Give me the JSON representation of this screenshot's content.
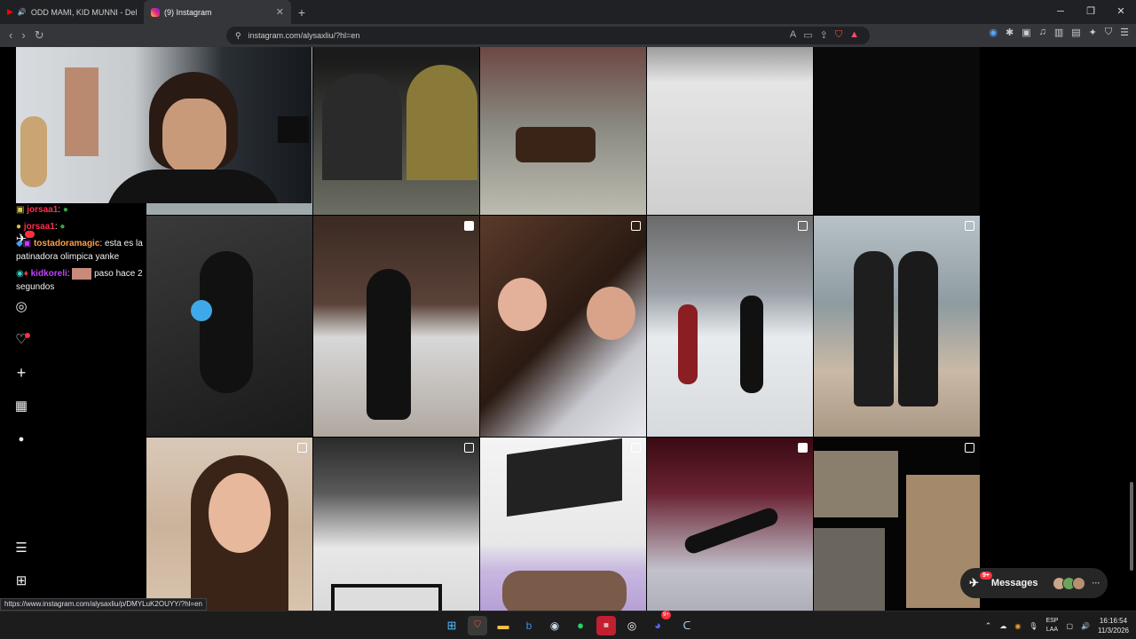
{
  "browser": {
    "tabs": [
      {
        "title": "ODD MAMI, KID MUNNI - Delore",
        "active": false
      },
      {
        "title": "(9) Instagram",
        "active": true
      }
    ],
    "url": "instagram.com/alysaxliu/?hl=en",
    "status_url": "https://www.instagram.com/alysaxliu/p/DMYLuK2OUYY/?hl=en"
  },
  "chat": [
    {
      "user": "jorsaa1",
      "text": ""
    },
    {
      "user": "jorsaa1",
      "text": ""
    },
    {
      "user": "tostadoramagic",
      "text": "esta es la patinadora olimpica yanke"
    },
    {
      "user": "kidkoreli",
      "text": "paso hace 2 segundos"
    }
  ],
  "sidebar": {
    "notifications_badge": "9+"
  },
  "messages": {
    "label": "Messages",
    "badge": "9+"
  },
  "taskbar": {
    "lang_top": "ESP",
    "lang_bottom": "LAA",
    "time": "16:16:54",
    "date": "11/3/2026",
    "discord_badge": "9+"
  }
}
